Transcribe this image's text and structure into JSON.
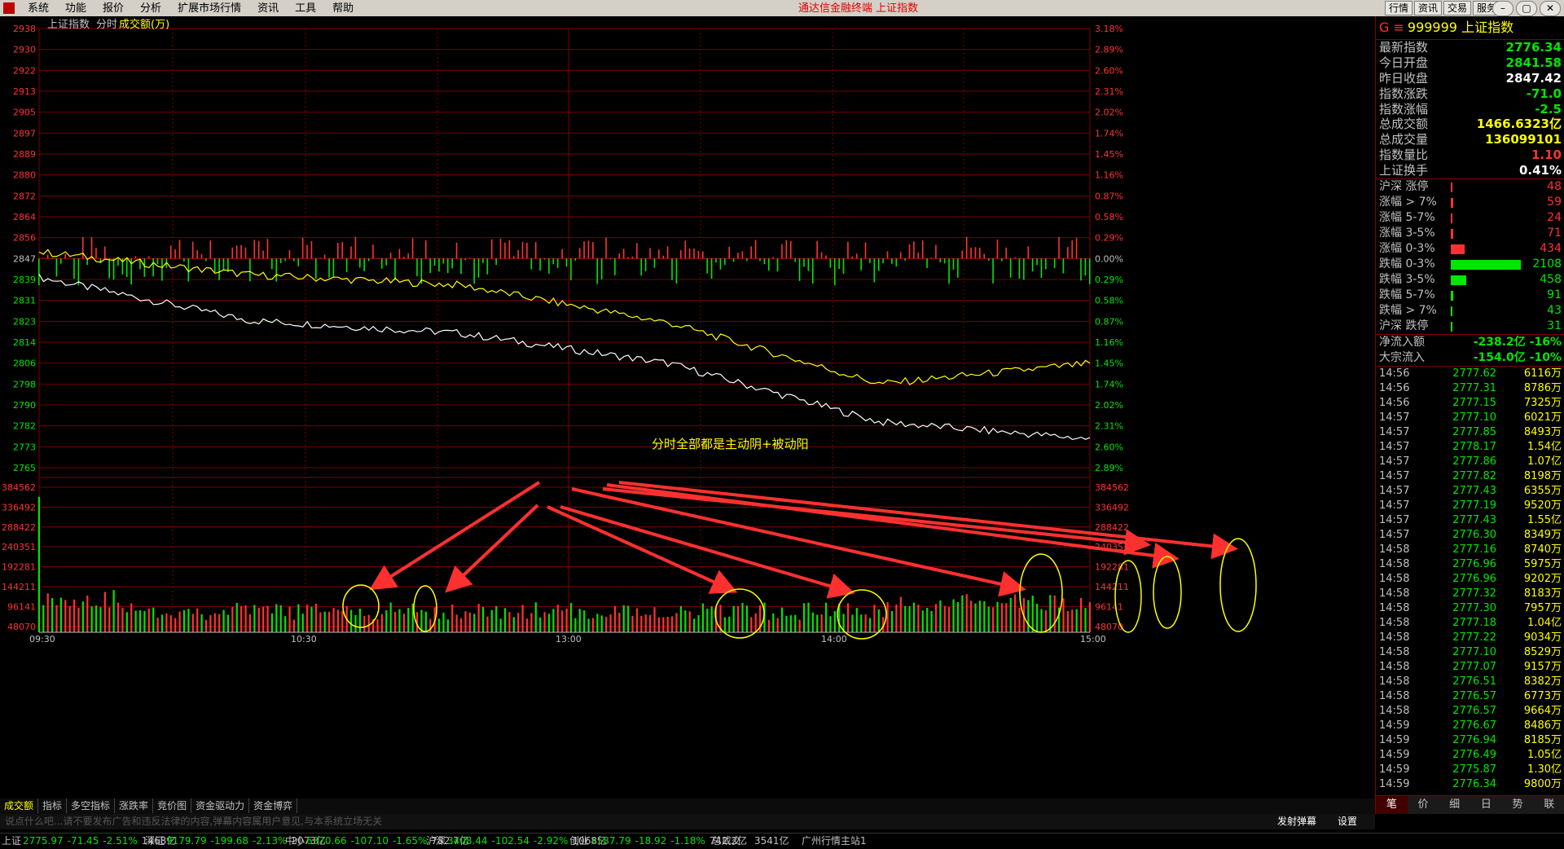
{
  "menubar": {
    "items": [
      "系统",
      "功能",
      "报价",
      "分析",
      "扩展市场行情",
      "资讯",
      "工具",
      "帮助"
    ],
    "app_title": "通达信金融终端   上证指数",
    "right_buttons": [
      "行情",
      "资讯",
      "交易",
      "服务"
    ],
    "window_controls": [
      "–",
      "▢",
      "✕"
    ]
  },
  "chart": {
    "header": {
      "name": "上证指数",
      "mode": "分时",
      "volume_label": "成交额(万)"
    },
    "annotation": "分时全部都是主动阴+被动阳",
    "price_ticks": [
      "2938",
      "2930",
      "2922",
      "2913",
      "2905",
      "2897",
      "2889",
      "2880",
      "2872",
      "2864",
      "2856",
      "2847",
      "2839",
      "2831",
      "2823",
      "2814",
      "2806",
      "2798",
      "2790",
      "2782",
      "2773",
      "2765"
    ],
    "pct_ticks": [
      "3.18%",
      "2.89%",
      "2.60%",
      "2.31%",
      "2.02%",
      "1.74%",
      "1.45%",
      "1.16%",
      "0.87%",
      "0.58%",
      "0.29%",
      "0.00%",
      "0.29%",
      "0.58%",
      "0.87%",
      "1.16%",
      "1.45%",
      "1.74%",
      "2.02%",
      "2.31%",
      "2.60%",
      "2.89%"
    ],
    "vol_ticks": [
      "384562",
      "336492",
      "288422",
      "240351",
      "192281",
      "144211",
      "96141",
      "48070"
    ],
    "time_labels": [
      "09:30",
      "10:30",
      "13:00",
      "14:00",
      "15:00"
    ],
    "colors": {
      "up": "#ff3232",
      "down": "#00e600",
      "grid": "#800000",
      "price": "#ffffff",
      "avg": "#ffff00",
      "annotation": "#ffff00",
      "arrow": "#ff3030"
    },
    "markers": "×"
  },
  "chart_data": {
    "type": "line",
    "title": "上证指数 分时",
    "x": [
      "09:30",
      "10:30",
      "13:00",
      "14:00",
      "15:00"
    ],
    "series": [
      {
        "name": "价格",
        "values": [
          2840,
          2823,
          2818,
          2806,
          2783,
          2776.34
        ]
      },
      {
        "name": "均价",
        "values": [
          2850,
          2841,
          2837,
          2822,
          2798,
          2806
        ]
      }
    ],
    "ylim": [
      2765,
      2938
    ],
    "prev_close": 2847.42,
    "volume_ylim": [
      0,
      384562
    ]
  },
  "quote": {
    "code": "999999",
    "name": "上证指数",
    "rows": [
      {
        "label": "最新指数",
        "value": "2776.34",
        "cls": "dn"
      },
      {
        "label": "今日开盘",
        "value": "2841.58",
        "cls": "dn"
      },
      {
        "label": "昨日收盘",
        "value": "2847.42",
        "cls": "wh"
      },
      {
        "label": "指数涨跌",
        "value": "-71.0",
        "cls": "dn"
      },
      {
        "label": "指数涨幅",
        "value": "-2.5",
        "cls": "dn"
      },
      {
        "label": "总成交额",
        "value": "1466.6323亿",
        "cls": "yl"
      },
      {
        "label": "总成交量",
        "value": "136099101",
        "cls": "yl"
      },
      {
        "label": "指数量比",
        "value": "1.10",
        "cls": "up"
      },
      {
        "label": "上证换手",
        "value": "0.41%",
        "cls": "wh"
      }
    ],
    "breadth": [
      {
        "label": "沪深 涨停",
        "value": "48",
        "frac": 0.02,
        "cls": "up"
      },
      {
        "label": "涨幅 > 7%",
        "value": "59",
        "frac": 0.03,
        "cls": "up"
      },
      {
        "label": "涨幅 5-7%",
        "value": "24",
        "frac": 0.015,
        "cls": "up"
      },
      {
        "label": "涨幅 3-5%",
        "value": "71",
        "frac": 0.035,
        "cls": "up"
      },
      {
        "label": "涨幅 0-3%",
        "value": "434",
        "frac": 0.2,
        "cls": "up"
      },
      {
        "label": "跌幅 0-3%",
        "value": "2108",
        "frac": 1.0,
        "cls": "dn"
      },
      {
        "label": "跌幅 3-5%",
        "value": "458",
        "frac": 0.22,
        "cls": "dn"
      },
      {
        "label": "跌幅 5-7%",
        "value": "91",
        "frac": 0.04,
        "cls": "dn"
      },
      {
        "label": "跌幅 > 7%",
        "value": "43",
        "frac": 0.02,
        "cls": "dn"
      },
      {
        "label": "沪深 跌停",
        "value": "31",
        "frac": 0.015,
        "cls": "dn"
      }
    ],
    "flows": [
      {
        "label": "净流入额",
        "value": "-238.2亿  -16%"
      },
      {
        "label": "大宗流入",
        "value": "-154.0亿  -10%"
      }
    ],
    "trades": [
      [
        "14:56",
        "2777.62",
        "6116万"
      ],
      [
        "14:56",
        "2777.31",
        "8786万"
      ],
      [
        "14:56",
        "2777.15",
        "7325万"
      ],
      [
        "14:57",
        "2777.10",
        "6021万"
      ],
      [
        "14:57",
        "2777.85",
        "8493万"
      ],
      [
        "14:57",
        "2778.17",
        "1.54亿"
      ],
      [
        "14:57",
        "2777.86",
        "1.07亿"
      ],
      [
        "14:57",
        "2777.82",
        "8198万"
      ],
      [
        "14:57",
        "2777.43",
        "6355万"
      ],
      [
        "14:57",
        "2777.19",
        "9520万"
      ],
      [
        "14:57",
        "2777.43",
        "1.55亿"
      ],
      [
        "14:57",
        "2776.30",
        "8349万"
      ],
      [
        "14:58",
        "2777.16",
        "8740万"
      ],
      [
        "14:58",
        "2776.96",
        "5975万"
      ],
      [
        "14:58",
        "2776.96",
        "9202万"
      ],
      [
        "14:58",
        "2777.32",
        "8183万"
      ],
      [
        "14:58",
        "2777.30",
        "7957万"
      ],
      [
        "14:58",
        "2777.18",
        "1.04亿"
      ],
      [
        "14:58",
        "2777.22",
        "9034万"
      ],
      [
        "14:58",
        "2777.10",
        "8529万"
      ],
      [
        "14:58",
        "2777.07",
        "9157万"
      ],
      [
        "14:58",
        "2776.51",
        "8382万"
      ],
      [
        "14:58",
        "2776.57",
        "6773万"
      ],
      [
        "14:58",
        "2776.57",
        "9664万"
      ],
      [
        "14:59",
        "2776.67",
        "8486万"
      ],
      [
        "14:59",
        "2776.94",
        "8185万"
      ],
      [
        "14:59",
        "2776.49",
        "1.05亿"
      ],
      [
        "14:59",
        "2775.87",
        "1.30亿"
      ],
      [
        "14:59",
        "2776.34",
        "9800万"
      ]
    ],
    "bottom_tabs": [
      "笔",
      "价",
      "细",
      "日",
      "势",
      "联"
    ]
  },
  "tabs": [
    "成交额",
    "指标",
    "多空指标",
    "涨跌率",
    "竞价图",
    "资金驱动力",
    "资金博弈"
  ],
  "danmu": {
    "placeholder": "说点什么吧...请不要发布广告和违反法律的内容,弹幕内容属用户意见,与本系统立场无关",
    "send": "发射弹幕",
    "settings": "设置"
  },
  "sublinks": [
    "关弹幕",
    "扩展∧",
    "关联报价"
  ],
  "status": [
    {
      "name": "上证",
      "price": "2775.97",
      "chg": "-71.45",
      "pct": "-2.51%",
      "amt": "1468亿"
    },
    {
      "name": "深证",
      "price": "9179.79",
      "chg": "-199.68",
      "pct": "-2.13%",
      "amt": "2073亿"
    },
    {
      "name": "中小",
      "price": "6370.66",
      "chg": "-107.10",
      "pct": "-1.65%",
      "amt": "782.7亿"
    },
    {
      "name": "沪深",
      "price": "3408.44",
      "chg": "-102.54",
      "pct": "-2.92%",
      "amt": "1068亿"
    },
    {
      "name": "创业",
      "price": "1587.79",
      "chg": "-18.92",
      "pct": "-1.18%",
      "amt": "742.2亿"
    }
  ],
  "status_extra": {
    "total_label": "总成交",
    "total": "3541亿",
    "station": "广州行情主站1"
  }
}
